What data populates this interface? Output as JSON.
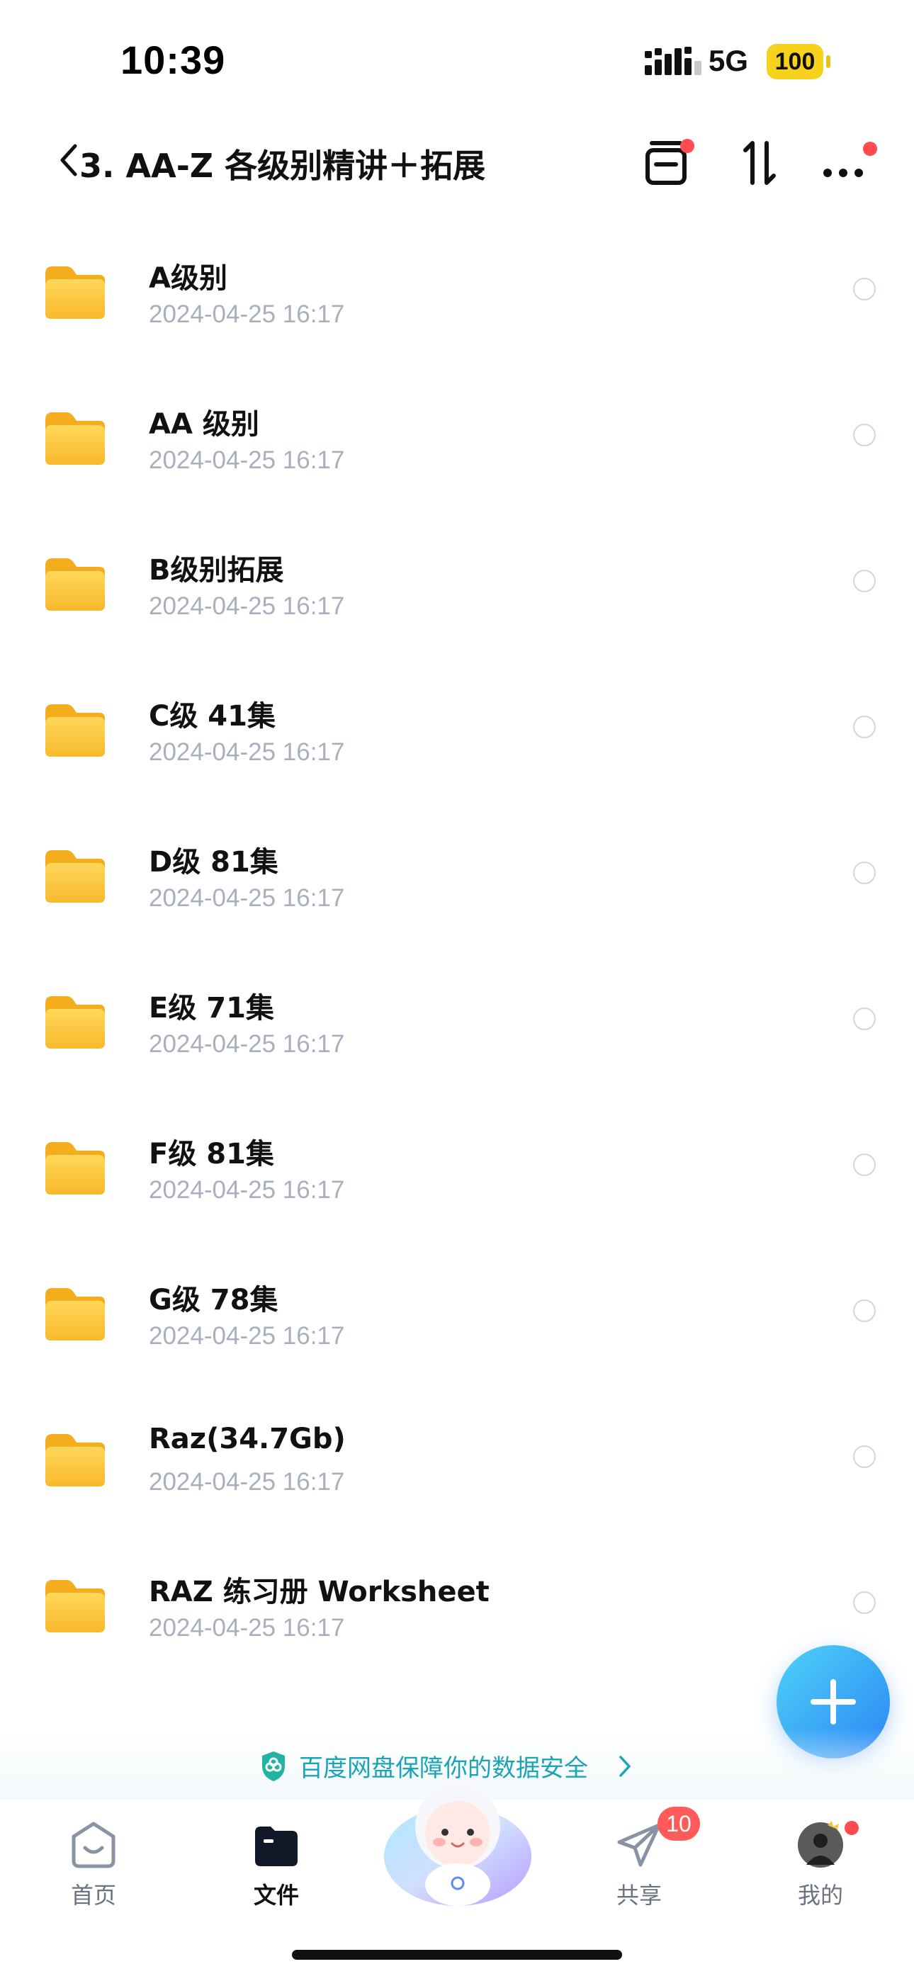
{
  "status_bar": {
    "time": "10:39",
    "network": "5G",
    "battery": "100"
  },
  "header": {
    "title": "3. AA-Z 各级别精讲＋拓展"
  },
  "files": [
    {
      "name": "A级别",
      "date": "2024-04-25 16:17"
    },
    {
      "name": "AA 级别",
      "date": "2024-04-25 16:17"
    },
    {
      "name": "B级别拓展",
      "date": "2024-04-25 16:17"
    },
    {
      "name": "C级 41集",
      "date": "2024-04-25 16:17"
    },
    {
      "name": "D级 81集",
      "date": "2024-04-25 16:17"
    },
    {
      "name": "E级 71集",
      "date": "2024-04-25 16:17"
    },
    {
      "name": "F级 81集",
      "date": "2024-04-25 16:17"
    },
    {
      "name": "G级 78集",
      "date": "2024-04-25 16:17"
    },
    {
      "name": "Raz(34.7Gb)",
      "date": "2024-04-25 16:17"
    },
    {
      "name": "RAZ 练习册 Worksheet",
      "date": "2024-04-25 16:17"
    }
  ],
  "security_banner": {
    "text": "百度网盘保障你的数据安全"
  },
  "tabbar": {
    "tabs": [
      {
        "label": "首页",
        "icon": "home-icon"
      },
      {
        "label": "文件",
        "icon": "folder-icon",
        "active": true
      },
      {
        "label": "",
        "icon": "assistant-mascot"
      },
      {
        "label": "共享",
        "icon": "send-icon",
        "badge": "10"
      },
      {
        "label": "我的",
        "icon": "avatar"
      }
    ]
  },
  "colors": {
    "accent": "#2a86f6",
    "folder": "#fbc63c",
    "badge": "#ff5b5b",
    "security_text": "#1aa4b8"
  }
}
